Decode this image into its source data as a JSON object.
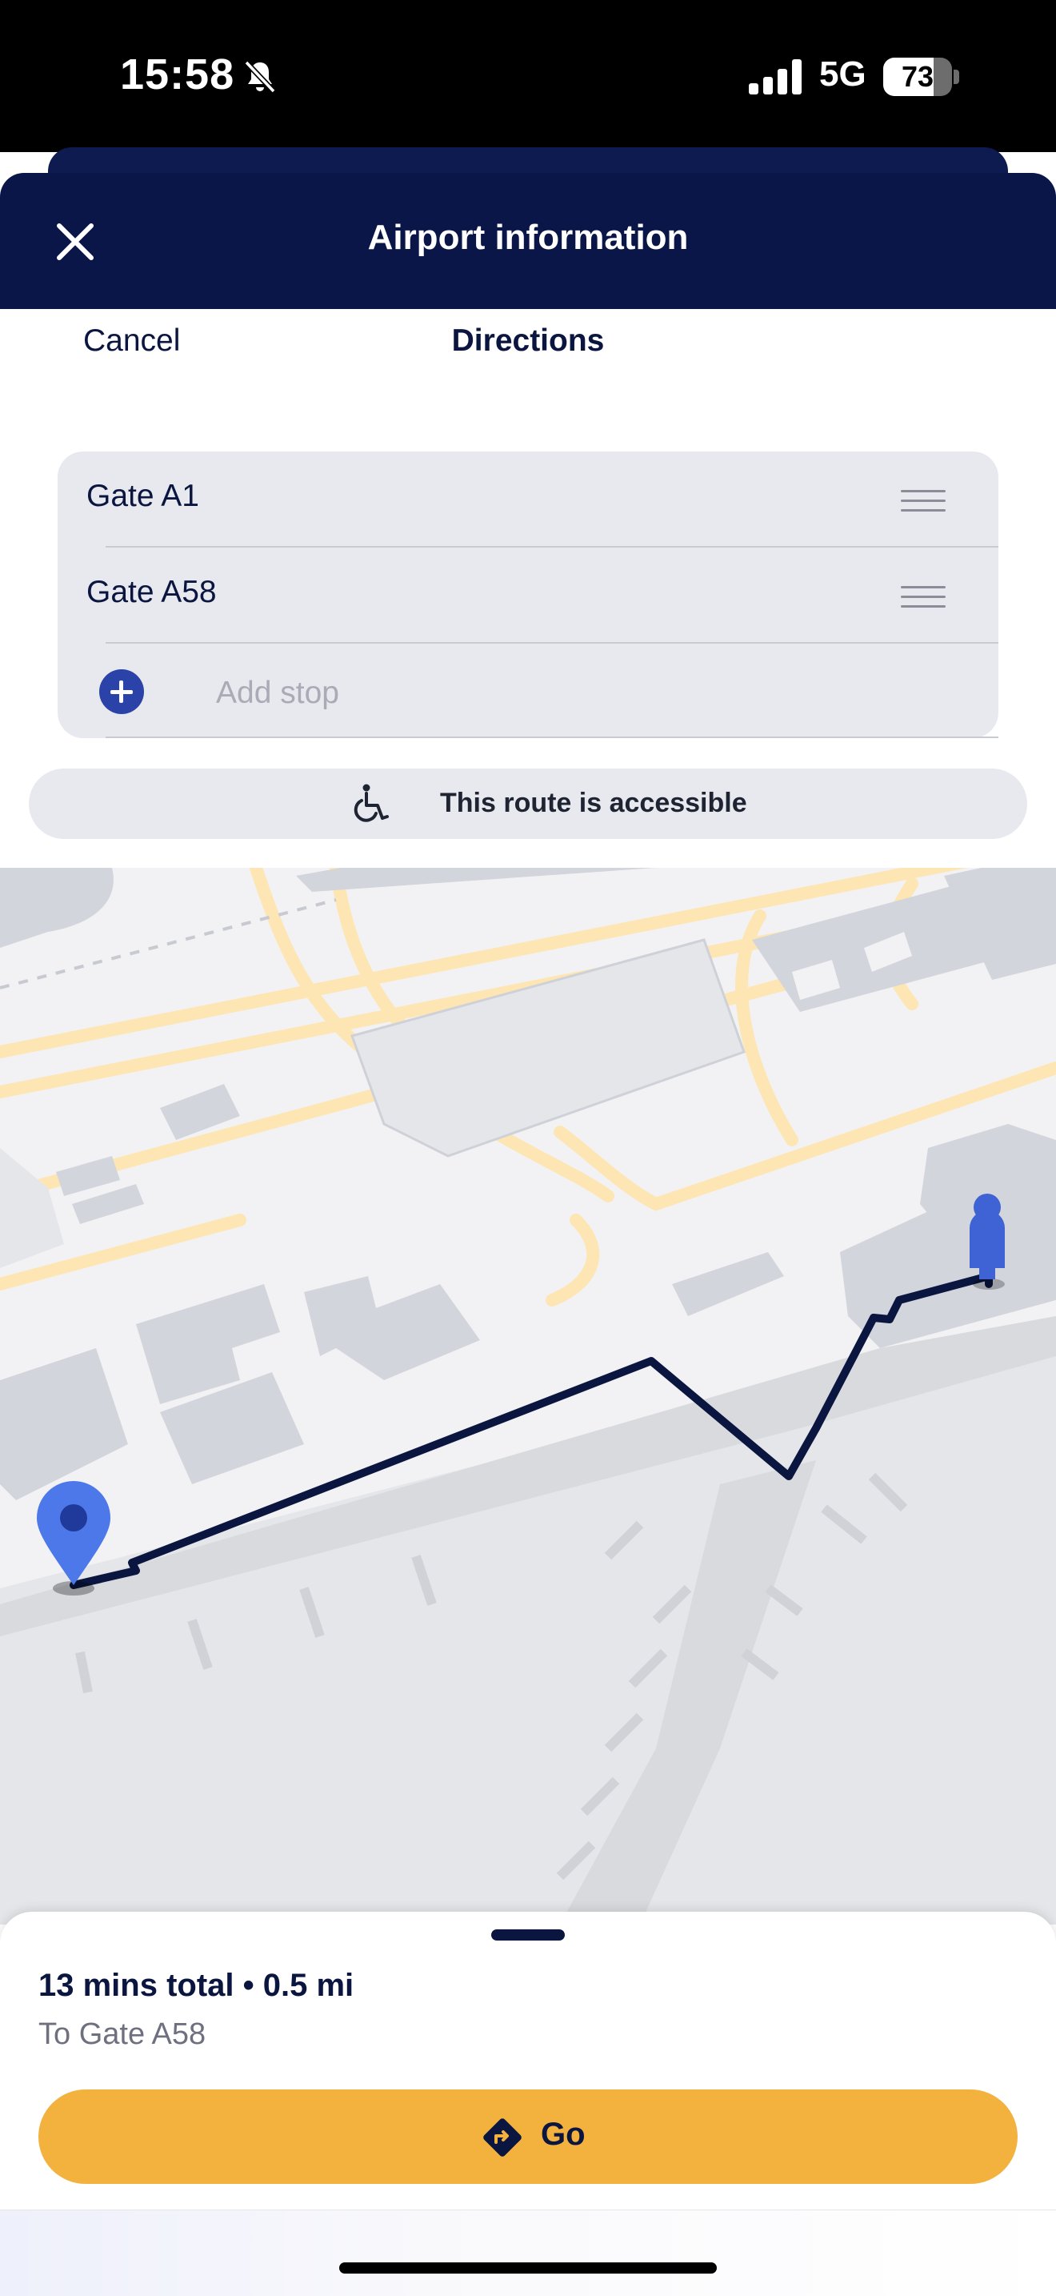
{
  "status_bar": {
    "time": "15:58",
    "network": "5G",
    "battery_percent": 73
  },
  "header": {
    "title": "Airport information"
  },
  "directions": {
    "cancel_label": "Cancel",
    "title": "Directions",
    "stops": [
      {
        "label": "Gate A1"
      },
      {
        "label": "Gate A58"
      }
    ],
    "add_stop_label": "Add stop",
    "accessibility_text": "This route is accessible"
  },
  "route_summary": {
    "summary": "13 mins total • 0.5 mi",
    "destination": "To Gate A58",
    "go_label": "Go"
  },
  "colors": {
    "header_bg": "#0a1647",
    "accent_blue": "#2b43a8",
    "go_button": "#f3b13e",
    "route_line": "#0b1640",
    "map_roads": "#fde6b3",
    "map_buildings": "#d3d5dc"
  }
}
